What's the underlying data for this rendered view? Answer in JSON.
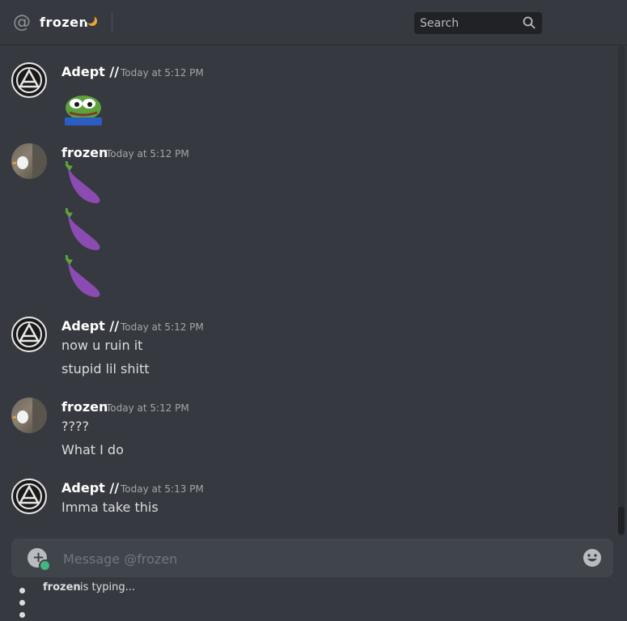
{
  "header": {
    "channel_name": "frozen",
    "search_placeholder": "Search"
  },
  "messages": [
    {
      "author": "Adept //",
      "timestamp": "Today at 5:12 PM",
      "content": [
        "[pepe emoji]"
      ]
    },
    {
      "author": "frozen",
      "timestamp": "Today at 5:12 PM",
      "content": [
        "🍆",
        "🍆",
        "🍆"
      ]
    },
    {
      "author": "Adept //",
      "timestamp": "Today at 5:12 PM",
      "content": [
        "now u ruin it",
        "stupid lil shitt"
      ]
    },
    {
      "author": "frozen",
      "timestamp": "Today at 5:12 PM",
      "content": [
        "????",
        "What I do"
      ]
    },
    {
      "author": "Adept //",
      "timestamp": "Today at 5:13 PM",
      "content": [
        "Imma take this"
      ]
    }
  ],
  "composer": {
    "placeholder": "Message @frozen"
  },
  "typing": {
    "user": "frozen",
    "text": "is typing..."
  },
  "colors": {
    "background": "#36393f",
    "input": "#40444b",
    "accent_green": "#43b581"
  },
  "icons": [
    "at-icon",
    "moon-icon",
    "search-icon",
    "attach-icon",
    "emoji-icon"
  ]
}
